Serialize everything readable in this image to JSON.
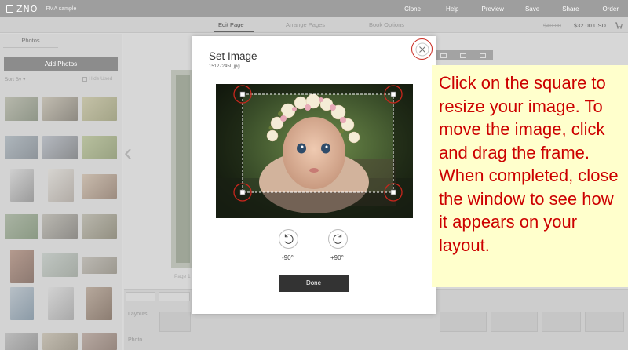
{
  "app": {
    "logo": "ZNO",
    "project": "FMA sample"
  },
  "topnav": [
    "Clone",
    "Help",
    "Preview",
    "Save",
    "Share",
    "Order"
  ],
  "subnav": {
    "tabs": [
      "Edit Page",
      "Arrange Pages",
      "Book Options"
    ],
    "active": 0,
    "old_price": "$40.00",
    "price": "$32.00 USD"
  },
  "left_panel": {
    "tab": "Photos",
    "add_button": "Add Photos",
    "sort_label": "Sort By ▾",
    "hide_used": "Hide Used"
  },
  "workspace": {
    "page_label": "Page 1",
    "layouts_label": "Layouts",
    "more_label": "Photo"
  },
  "modal": {
    "title": "Set Image",
    "filename": "15127245L.jpg",
    "rotate_left_label": "-90°",
    "rotate_right_label": "+90°",
    "done_label": "Done"
  },
  "callout": {
    "text": "Click on the square to resize your image. To move the image, click and drag the frame. When completed, close the window to see how it appears on your layout."
  },
  "colors": {
    "accent_red": "#c8261d",
    "callout_bg": "#ffffcc",
    "callout_text": "#cc0000",
    "done_bg": "#333333"
  }
}
